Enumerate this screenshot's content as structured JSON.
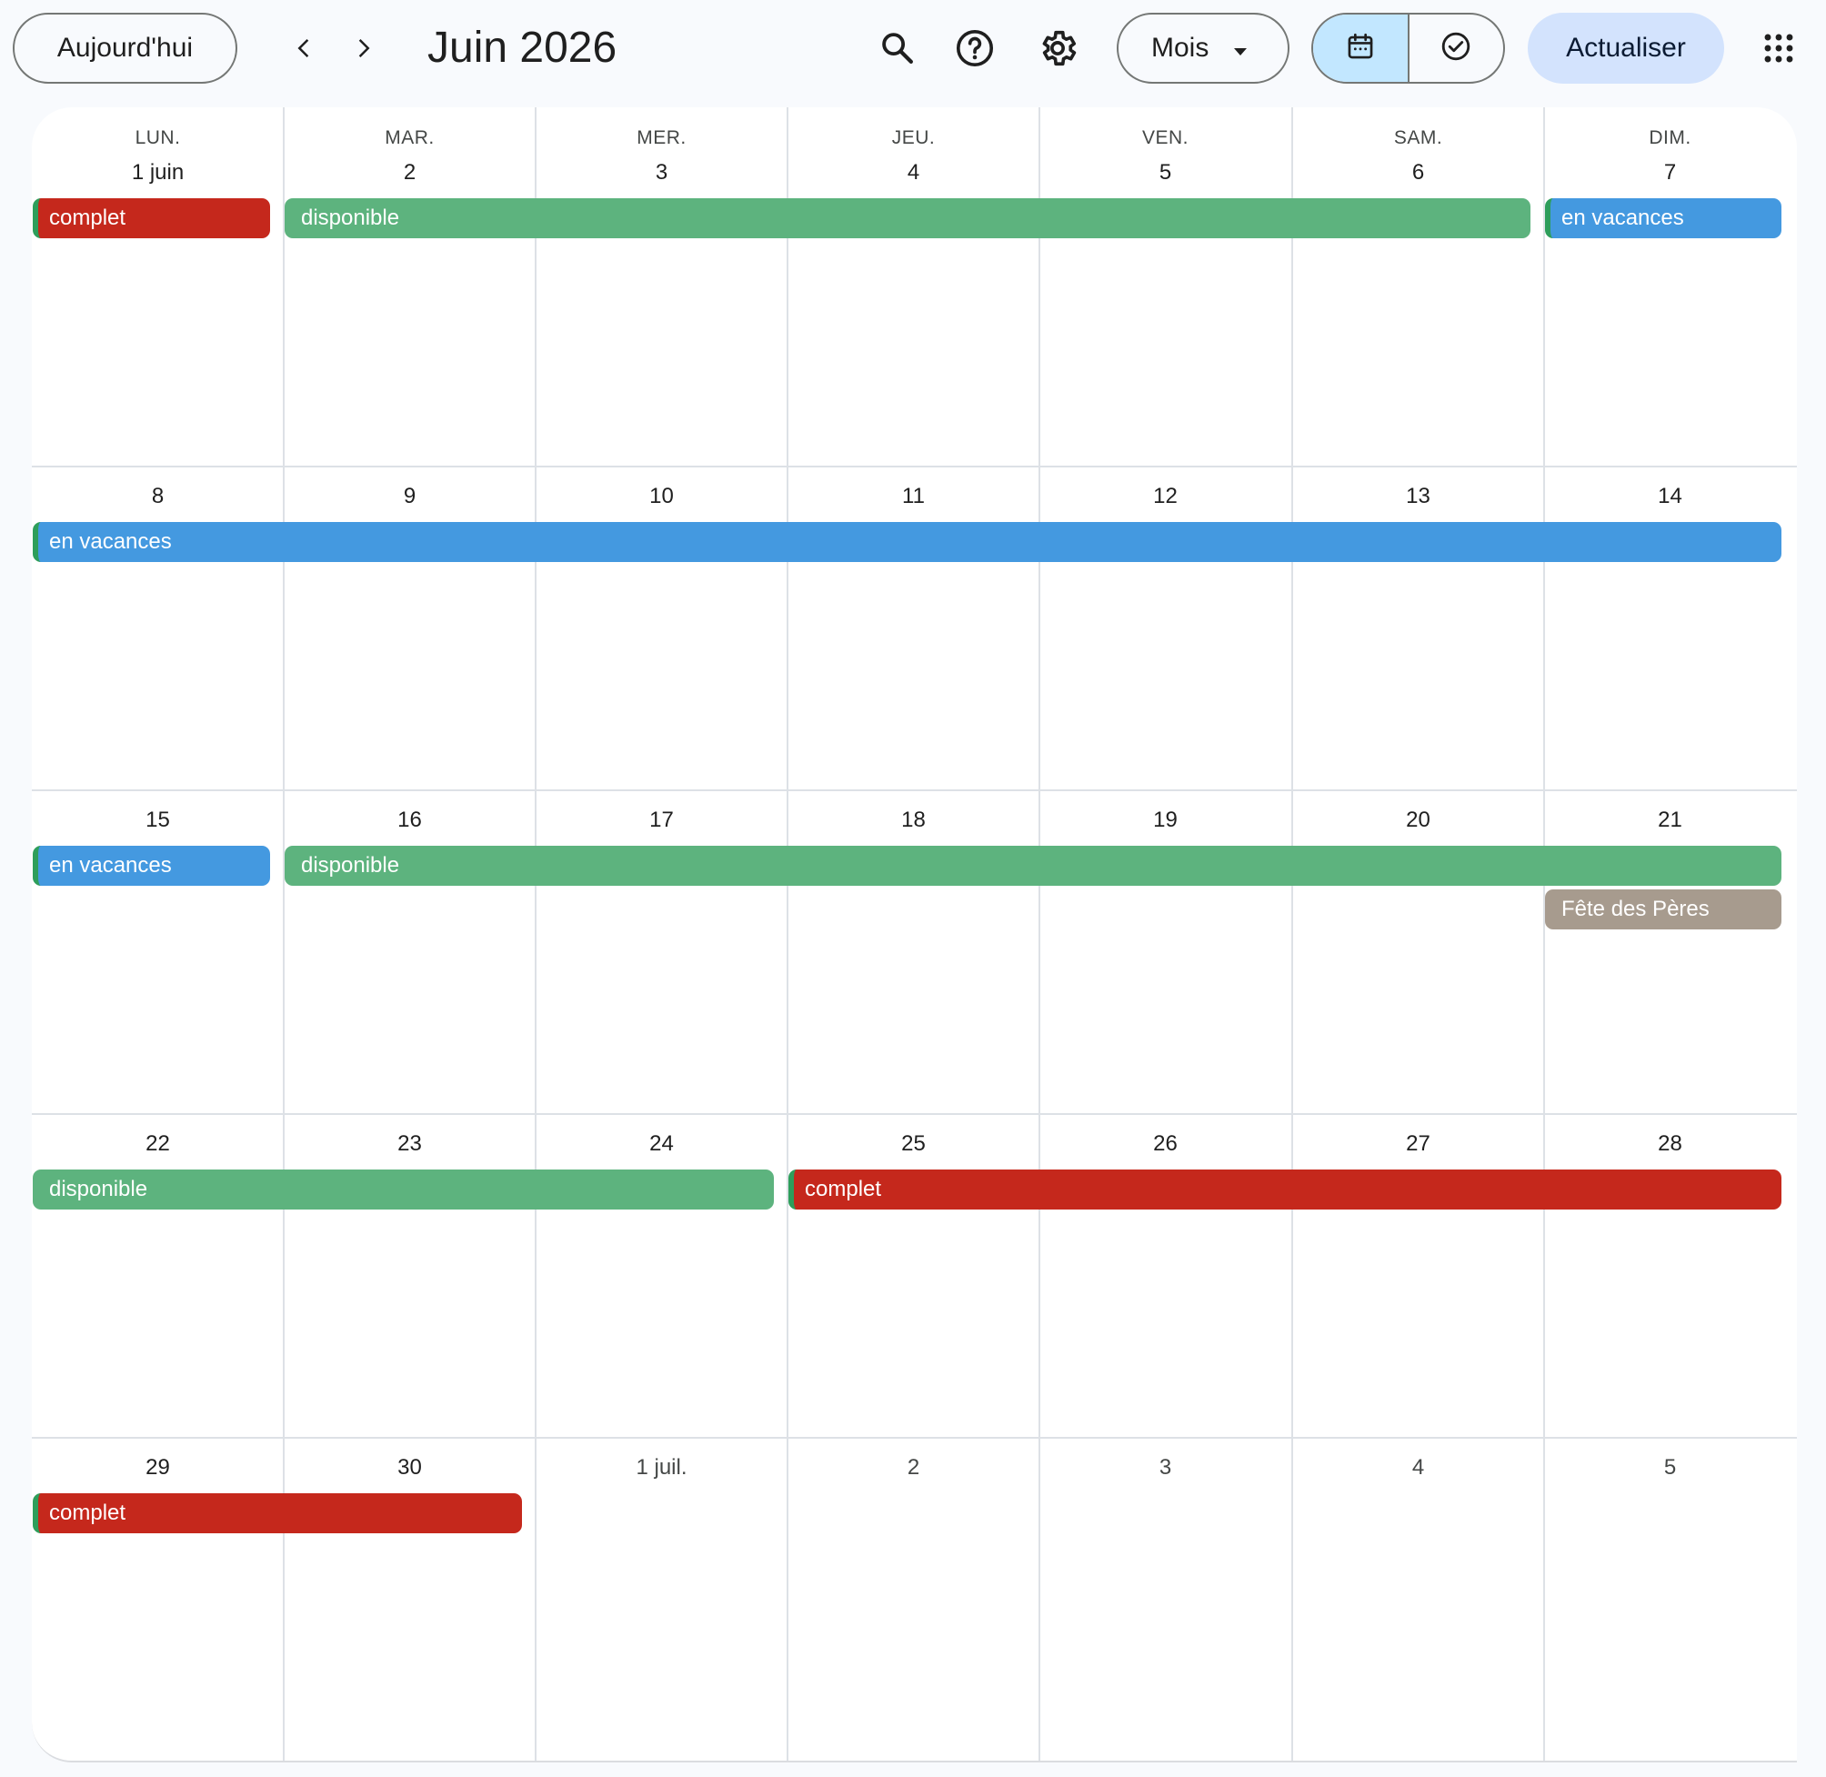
{
  "toolbar": {
    "today_label": "Aujourd'hui",
    "prev_icon": "chevron-left-icon",
    "next_icon": "chevron-right-icon",
    "title": "Juin 2026",
    "search_icon": "search-icon",
    "help_icon": "help-icon",
    "settings_icon": "gear-icon",
    "view_label": "Mois",
    "calendar_view_icon": "calendar-icon",
    "tasks_view_icon": "check-circle-icon",
    "refresh_label": "Actualiser",
    "apps_icon": "apps-grid-icon"
  },
  "calendar": {
    "weekdays": [
      "LUN.",
      "MAR.",
      "MER.",
      "JEU.",
      "VEN.",
      "SAM.",
      "DIM."
    ],
    "weeks": [
      [
        "1 juin",
        "2",
        "3",
        "4",
        "5",
        "6",
        "7"
      ],
      [
        "8",
        "9",
        "10",
        "11",
        "12",
        "13",
        "14"
      ],
      [
        "15",
        "16",
        "17",
        "18",
        "19",
        "20",
        "21"
      ],
      [
        "22",
        "23",
        "24",
        "25",
        "26",
        "27",
        "28"
      ],
      [
        "29",
        "30",
        "1 juil.",
        "2",
        "3",
        "4",
        "5"
      ]
    ],
    "events": {
      "w1_complet": "complet",
      "w1_disponible": "disponible",
      "w1_vacances": "en vacances",
      "w2_vacances": "en vacances",
      "w3_vacances": "en vacances",
      "w3_disponible": "disponible",
      "w3_fete": "Fête des Pères",
      "w4_disponible": "disponible",
      "w4_complet": "complet",
      "w5_complet": "complet"
    }
  },
  "colors": {
    "red": "#c5281c",
    "green": "#5db37e",
    "blue": "#4499e0",
    "grey": "#a79b8e",
    "accent_light": "#c2e7ff",
    "refresh_bg": "#d3e3fd"
  }
}
